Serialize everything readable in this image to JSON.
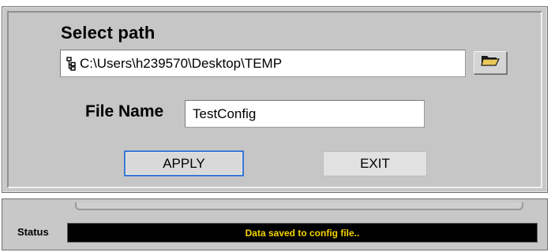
{
  "dialog": {
    "select_path_label": "Select path",
    "path_value": "C:\\Users\\h239570\\Desktop\\TEMP",
    "file_name_label": "File Name",
    "file_name_value": "TestConfig",
    "apply_label": "APPLY",
    "exit_label": "EXIT",
    "icons": {
      "path": "tree-path-icon",
      "browse": "folder-open-icon"
    }
  },
  "status": {
    "label": "Status",
    "message": "Data saved to config file..",
    "message_color": "#f5d400"
  }
}
